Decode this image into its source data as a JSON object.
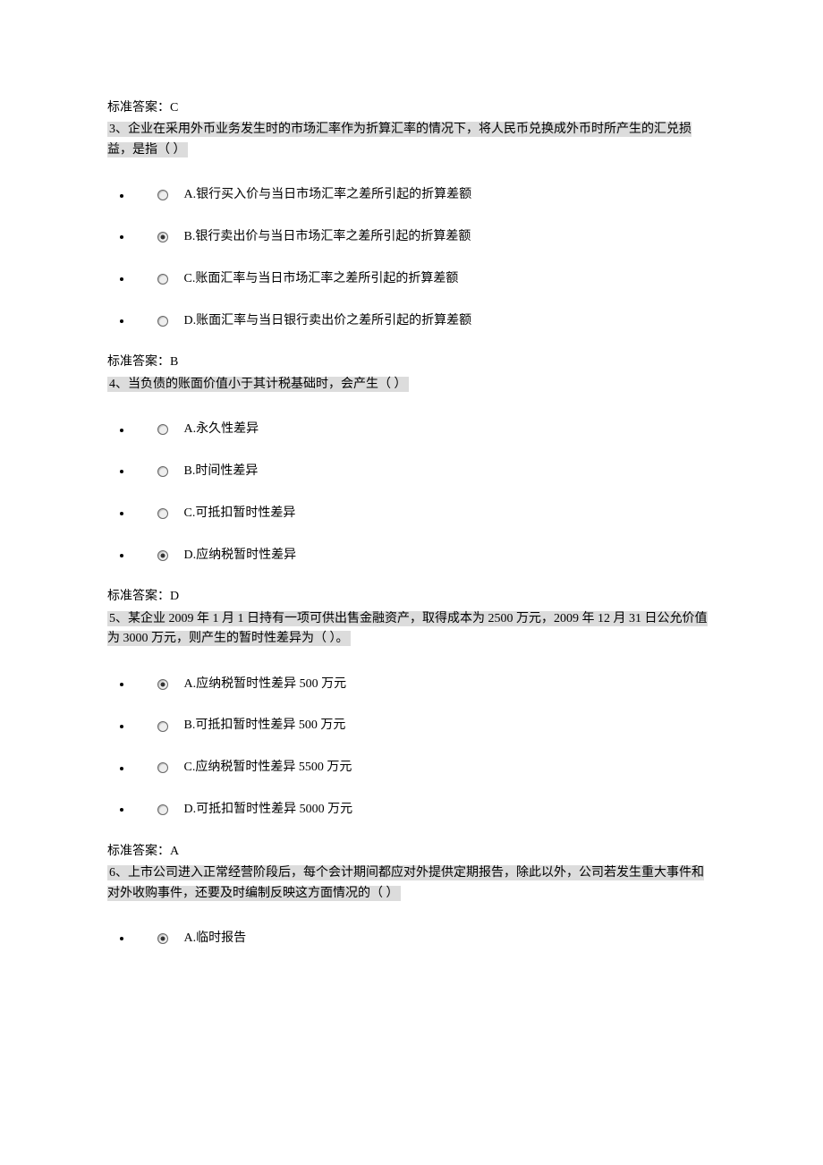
{
  "q2_answer": "标准答案：C",
  "q3": {
    "text": "3、企业在采用外币业务发生时的市场汇率作为折算汇率的情况下，将人民币兑换成外币时所产生的汇兑损益，是指（ ）",
    "options": [
      {
        "label": "A.银行买入价与当日市场汇率之差所引起的折算差额",
        "selected": false
      },
      {
        "label": "B.银行卖出价与当日市场汇率之差所引起的折算差额",
        "selected": true
      },
      {
        "label": "C.账面汇率与当日市场汇率之差所引起的折算差额",
        "selected": false
      },
      {
        "label": "D.账面汇率与当日银行卖出价之差所引起的折算差额",
        "selected": false
      }
    ],
    "answer": "标准答案：B"
  },
  "q4": {
    "text": "4、当负债的账面价值小于其计税基础时，会产生（ ）",
    "options": [
      {
        "label": "A.永久性差异",
        "selected": false
      },
      {
        "label": "B.时间性差异",
        "selected": false
      },
      {
        "label": "C.可抵扣暂时性差异",
        "selected": false
      },
      {
        "label": "D.应纳税暂时性差异",
        "selected": true
      }
    ],
    "answer": "标准答案：D"
  },
  "q5": {
    "text": "5、某企业 2009 年 1 月 1 日持有一项可供出售金融资产，取得成本为 2500 万元，2009 年 12 月 31 日公允价值为 3000 万元，则产生的暂时性差异为（ ）。",
    "options": [
      {
        "label": "A.应纳税暂时性差异 500 万元",
        "selected": true
      },
      {
        "label": "B.可抵扣暂时性差异 500 万元",
        "selected": false
      },
      {
        "label": "C.应纳税暂时性差异 5500 万元",
        "selected": false
      },
      {
        "label": "D.可抵扣暂时性差异 5000 万元",
        "selected": false
      }
    ],
    "answer": "标准答案：A"
  },
  "q6": {
    "text": "6、上市公司进入正常经营阶段后，每个会计期间都应对外提供定期报告，除此以外，公司若发生重大事件和对外收购事件，还要及时编制反映这方面情况的（ ）",
    "options": [
      {
        "label": "A.临时报告",
        "selected": true
      }
    ]
  }
}
